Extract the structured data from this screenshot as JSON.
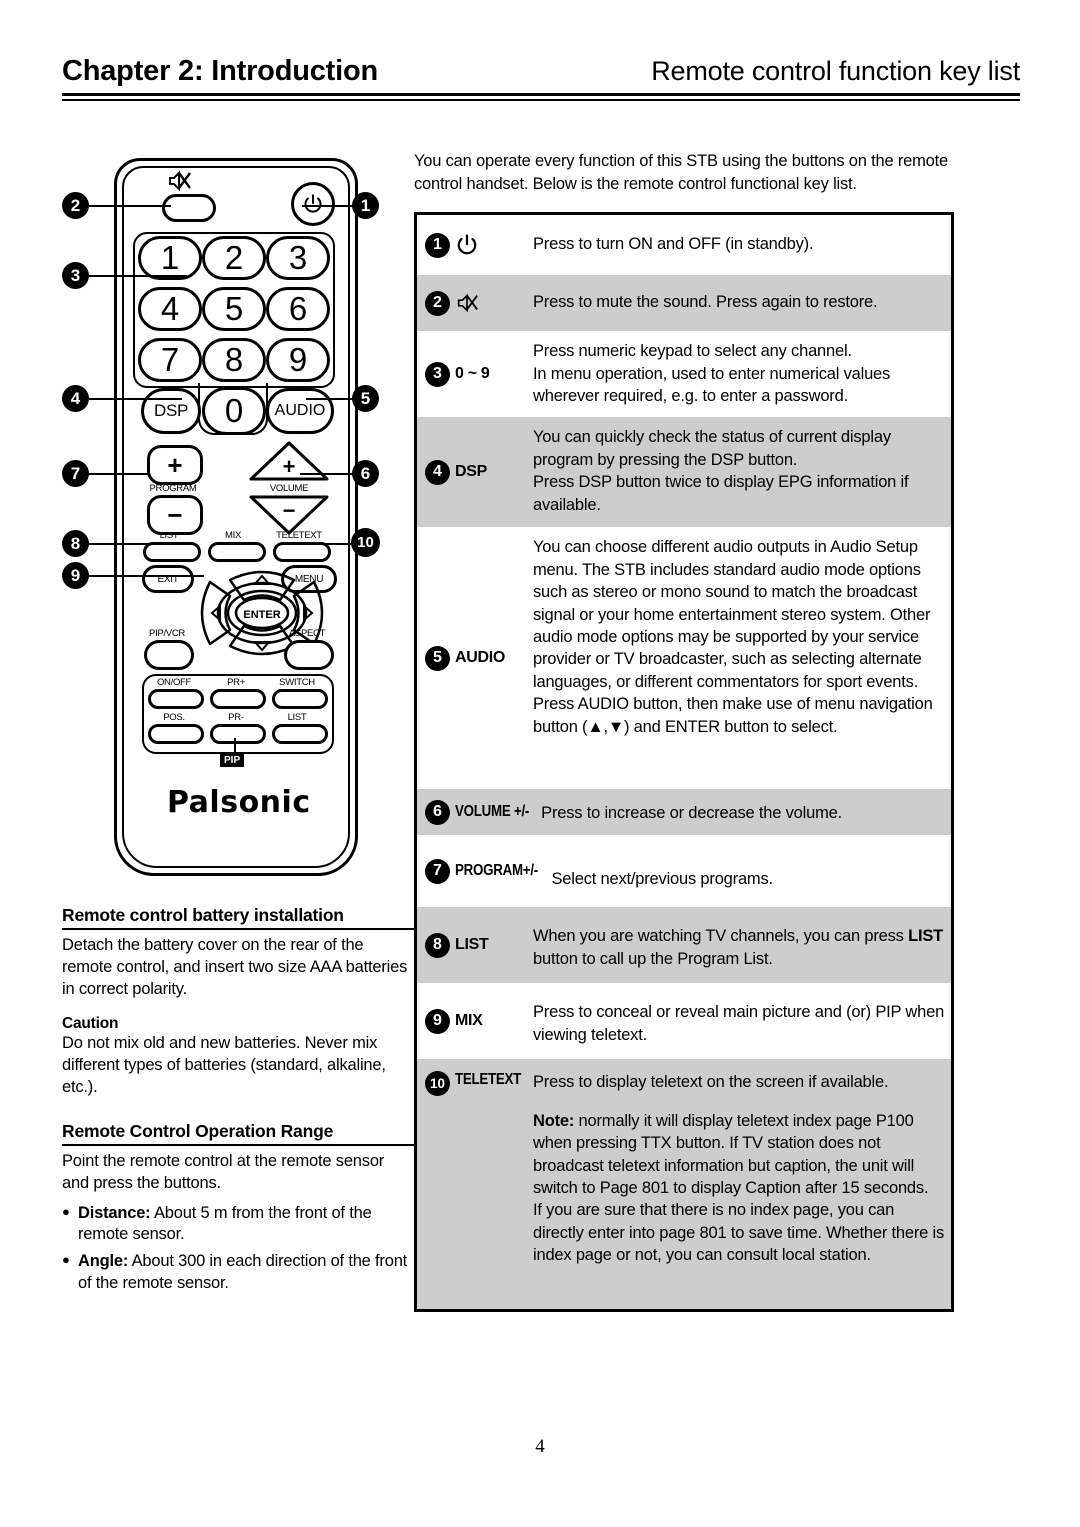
{
  "header": {
    "chapter": "Chapter 2: Introduction",
    "section": "Remote control function key list"
  },
  "remote": {
    "brand": "Palsonic",
    "pip_tag": "PIP",
    "callouts": [
      "1",
      "2",
      "3",
      "4",
      "5",
      "6",
      "7",
      "8",
      "9",
      "10"
    ],
    "keys": {
      "mute_icon": "mute-icon",
      "power_icon": "power-icon",
      "numbers": [
        "1",
        "2",
        "3",
        "4",
        "5",
        "6",
        "7",
        "8",
        "9",
        "0"
      ],
      "dsp": "DSP",
      "audio": "AUDIO",
      "program": "PROGRAM",
      "volume": "VOLUME",
      "list": "LIST",
      "mix": "MIX",
      "teletext": "TELETEXT",
      "exit": "EXIT",
      "menu": "MENU",
      "enter": "ENTER",
      "pip_vcr": "PIP/VCR",
      "aspect": "ASPECT",
      "on_off": "ON/OFF",
      "pr_plus": "PR+",
      "switch": "SWITCH",
      "pos": "POS.",
      "pr_minus": "PR-",
      "list2": "LIST",
      "plus": "+",
      "minus": "−"
    }
  },
  "left": {
    "battery": {
      "heading": "Remote control battery installation",
      "body": "Detach the battery cover on the rear of the remote control, and insert two size AAA batteries in correct polarity.",
      "caution_heading": "Caution",
      "caution_body": "Do not mix old and new batteries. Never mix different types of batteries (standard, alkaline, etc.)."
    },
    "range": {
      "heading": "Remote Control Operation Range",
      "body": "Point the remote control at the remote sensor and press the buttons.",
      "bullets": [
        {
          "label": "Distance:",
          "text": " About 5 m from the front of the remote sensor."
        },
        {
          "label": "Angle:",
          "text": " About 300 in each direction of the front of the remote sensor."
        }
      ]
    }
  },
  "right": {
    "intro": "You can operate every function of this STB using the buttons on the remote control handset. Below is the remote control functional key list.",
    "rows": [
      {
        "num": "1",
        "key": "power-icon",
        "key_type": "icon",
        "desc": "Press to turn ON and OFF (in standby).",
        "shade": false
      },
      {
        "num": "2",
        "key": "mute-icon",
        "key_type": "icon",
        "desc": "Press to mute the sound. Press again to restore.",
        "shade": true
      },
      {
        "num": "3",
        "key": "0 ~ 9",
        "key_type": "text",
        "desc": "Press numeric keypad to select any channel.\nIn menu operation, used to enter numerical values wherever required, e.g. to enter a password.",
        "shade": false
      },
      {
        "num": "4",
        "key": "DSP",
        "key_type": "text",
        "desc": "You can quickly check the status of current display program by pressing the DSP button.\nPress DSP button twice to display EPG information if available.",
        "shade": true
      },
      {
        "num": "5",
        "key": "AUDIO",
        "key_type": "text",
        "desc": "You can choose different audio outputs in Audio Setup menu. The STB includes standard audio mode options such as stereo or mono sound to match the broadcast signal or your home entertainment stereo system. Other audio mode options may be supported by your service provider or TV broadcaster, such as selecting alternate languages, or different commentators for sport events.\nPress AUDIO button, then make use of menu navigation button (▲,▼) and ENTER button to select.",
        "shade": false
      },
      {
        "num": "6",
        "key": "VOLUME +/-",
        "key_type": "condensed",
        "desc": "Press to increase or decrease the volume.",
        "shade": true
      },
      {
        "num": "7",
        "key": "PROGRAM+/-",
        "key_type": "condensed",
        "desc": "Select next/previous programs.",
        "shade": false
      },
      {
        "num": "8",
        "key": "LIST",
        "key_type": "text",
        "desc": "When you are watching TV channels, you can press LIST button to call up the Program List.",
        "shade": true
      },
      {
        "num": "9",
        "key": "MIX",
        "key_type": "text",
        "desc": "Press to conceal or reveal main picture and (or) PIP when viewing teletext.",
        "shade": false
      },
      {
        "num": "10",
        "key": "TELETEXT",
        "key_type": "condensed",
        "desc": "Press to display teletext on the screen if available.",
        "note_label": "Note:",
        "note": " normally it will display teletext index page P100 when pressing TTX button. If TV station does not broadcast teletext information but caption, the unit will switch to Page 801 to display Caption after 15 seconds.\nIf you are sure that there is no index page, you can directly enter into page 801 to save time. Whether there is index page or not, you can consult local station.",
        "shade": true
      }
    ]
  },
  "footer": {
    "page_number": "4"
  }
}
